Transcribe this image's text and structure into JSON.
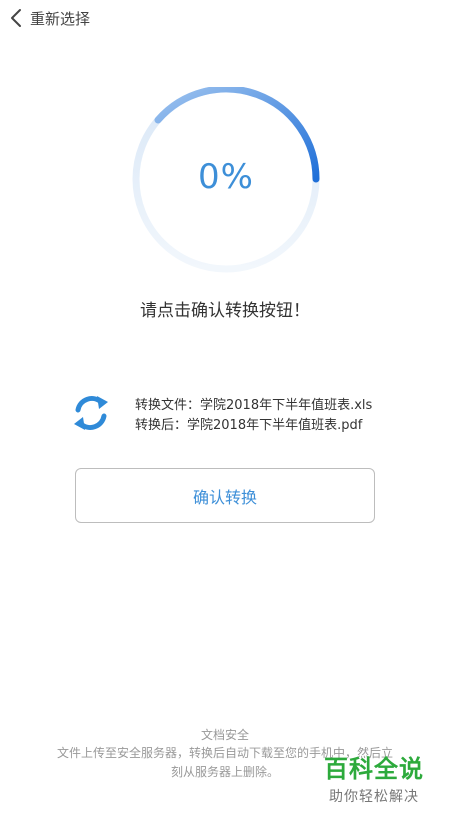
{
  "header": {
    "back_label": "重新选择"
  },
  "progress": {
    "percent_text": "0%",
    "value": 0
  },
  "prompt": "请点击确认转换按钮！",
  "file": {
    "source": "转换文件：学院2018年下半年值班表.xls",
    "target": "转换后：学院2018年下半年值班表.pdf"
  },
  "confirm_button": "确认转换",
  "footer": {
    "title": "文档安全",
    "text": "文件上传至安全服务器，转换后自动下载至您的手机中，然后立刻从服务器上删除。"
  },
  "watermark": {
    "main": "百科全说",
    "sub": "助你轻松解决"
  },
  "colors": {
    "accent": "#3d8fd8",
    "ring_track": "#e6eff9",
    "watermark": "#2daa3c"
  }
}
